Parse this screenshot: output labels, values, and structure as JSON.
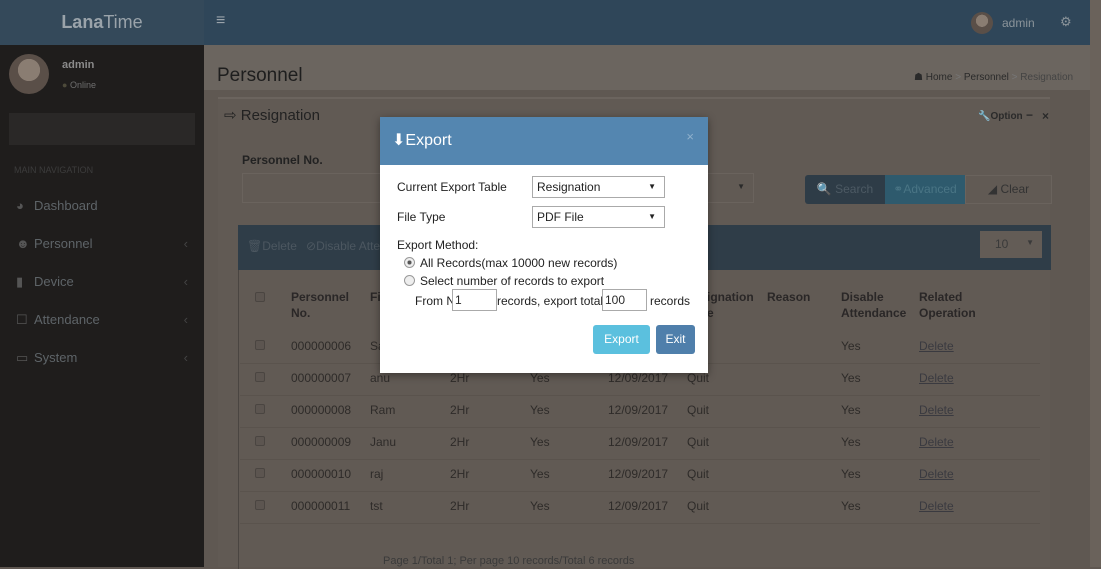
{
  "app": {
    "logo_bold": "Lana",
    "logo_rest": "Time",
    "menu_icon": "hamburger-icon",
    "user": "admin",
    "settings_icon": "gears-icon"
  },
  "sidebar": {
    "user": "admin",
    "status": "Online",
    "section": "MAIN NAVIGATION",
    "items": [
      {
        "label": "Dashboard",
        "icon": "dashboard-icon"
      },
      {
        "label": "Personnel",
        "icon": "users-icon"
      },
      {
        "label": "Device",
        "icon": "device-icon"
      },
      {
        "label": "Attendance",
        "icon": "attendance-icon"
      },
      {
        "label": "System",
        "icon": "laptop-icon"
      }
    ]
  },
  "page": {
    "title": "Personnel",
    "breadcrumb": [
      "Home",
      "Personnel",
      "Resignation"
    ]
  },
  "box": {
    "title": "Resignation",
    "option": "Option",
    "filter_label": "Personnel No.",
    "search": "Search",
    "advanced": "Advanced",
    "clear": "Clear",
    "delete": "Delete",
    "disable": "Disable Atte",
    "page_size": "10",
    "headers": [
      "Personnel No.",
      "Fi",
      "ignation e",
      "Reason",
      "Disable Attendance",
      "Related Operation"
    ],
    "rows": [
      [
        "000000006",
        "Sa",
        "",
        "",
        "",
        "",
        "",
        "Yes",
        "Delete"
      ],
      [
        "000000007",
        "anu",
        "2Hr",
        "Yes",
        "12/09/2017",
        "Quit",
        "",
        "Yes",
        "Delete"
      ],
      [
        "000000008",
        "Ram",
        "2Hr",
        "Yes",
        "12/09/2017",
        "Quit",
        "",
        "Yes",
        "Delete"
      ],
      [
        "000000009",
        "Janu",
        "2Hr",
        "Yes",
        "12/09/2017",
        "Quit",
        "",
        "Yes",
        "Delete"
      ],
      [
        "000000010",
        "raj",
        "2Hr",
        "Yes",
        "12/09/2017",
        "Quit",
        "",
        "Yes",
        "Delete"
      ],
      [
        "000000011",
        "tst",
        "2Hr",
        "Yes",
        "12/09/2017",
        "Quit",
        "",
        "Yes",
        "Delete"
      ]
    ],
    "pagination": "Page 1/Total 1; Per page 10 records/Total 6 records"
  },
  "modal": {
    "title": "Export",
    "table_label": "Current Export Table",
    "table_value": "Resignation",
    "type_label": "File Type",
    "type_value": "PDF File",
    "method_label": "Export Method:",
    "opt_all": "All Records(max 10000 new records)",
    "opt_select": "Select number of records to export",
    "selected_option": "all",
    "from_label": "From No.",
    "from_value": "1",
    "mid_label": "records, export total",
    "total_value": "100",
    "end_label": "records",
    "export": "Export",
    "exit": "Exit",
    "colors": {
      "header": "#5486b0",
      "export": "#5bc0de",
      "exit": "#4f7fab"
    }
  }
}
